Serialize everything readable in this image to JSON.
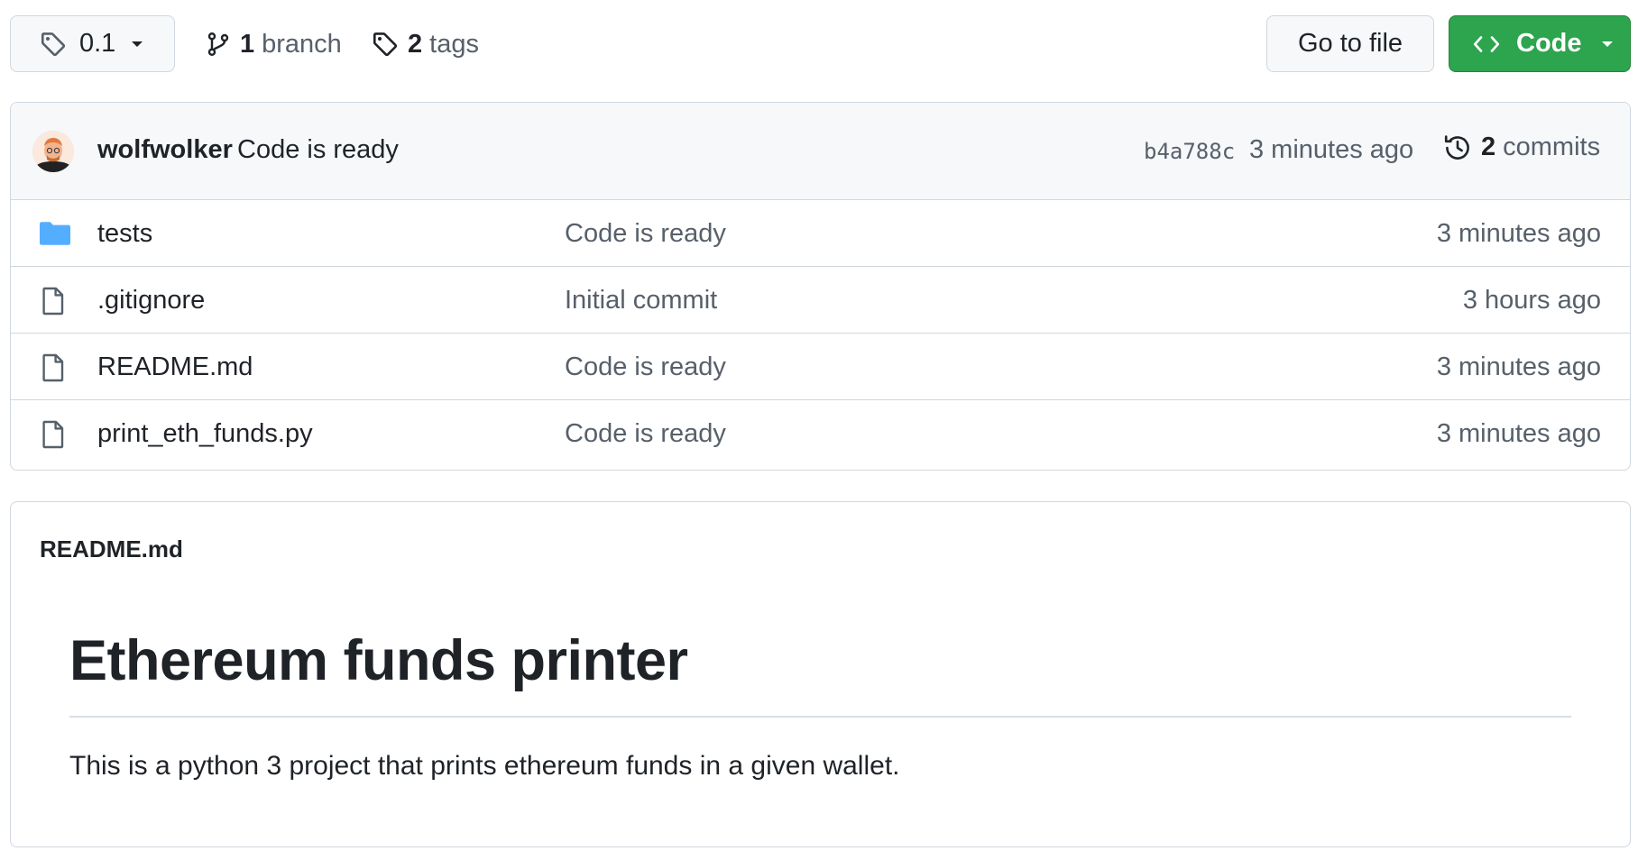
{
  "toolbar": {
    "tag_selector": {
      "label": "0.1",
      "icon": "tag-icon"
    },
    "branches": {
      "count": "1",
      "label": "branch",
      "icon": "git-branch-icon"
    },
    "tags": {
      "count": "2",
      "label": "tags",
      "icon": "tag-icon"
    },
    "go_to_file_label": "Go to file",
    "code_button_label": "Code"
  },
  "latest_commit": {
    "author": "wolfwolker",
    "message": "Code is ready",
    "sha": "b4a788c",
    "time": "3 minutes ago",
    "commit_count": "2",
    "commit_count_label": "commits"
  },
  "files": [
    {
      "name": "tests",
      "type": "folder",
      "icon": "folder-icon",
      "message": "Code is ready",
      "time": "3 minutes ago"
    },
    {
      "name": ".gitignore",
      "type": "file",
      "icon": "file-icon",
      "message": "Initial commit",
      "time": "3 hours ago"
    },
    {
      "name": "README.md",
      "type": "file",
      "icon": "file-icon",
      "message": "Code is ready",
      "time": "3 minutes ago"
    },
    {
      "name": "print_eth_funds.py",
      "type": "file",
      "icon": "file-icon",
      "message": "Code is ready",
      "time": "3 minutes ago"
    }
  ],
  "readme": {
    "filename": "README.md",
    "heading": "Ethereum funds printer",
    "paragraph": "This is a python 3 project that prints ethereum funds in a given wallet."
  },
  "colors": {
    "code_button": "#2da44e",
    "folder": "#54aeff",
    "border": "#d0d7de",
    "muted_text": "#57606a"
  }
}
